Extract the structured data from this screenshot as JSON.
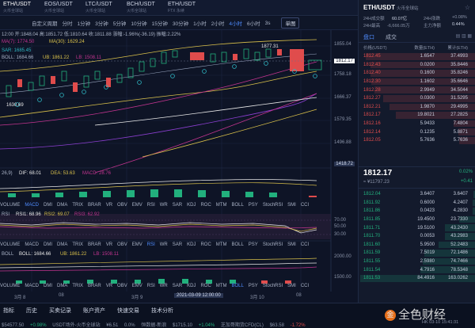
{
  "pair_tabs": [
    {
      "symbol": "ETH/USDT",
      "exchange": "火币全球站"
    },
    {
      "symbol": "EOS/USDT",
      "exchange": "火币全球站"
    },
    {
      "symbol": "LTC/USDT",
      "exchange": "火币全球站"
    },
    {
      "symbol": "BCH/USDT",
      "exchange": "火币全球站"
    },
    {
      "symbol": "ETH/USDT",
      "exchange": "FTX 永续"
    }
  ],
  "toolbar": {
    "items": [
      "自定义周期",
      "分时",
      "1分钟",
      "3分钟",
      "5分钟",
      "10分钟",
      "15分钟",
      "30分钟",
      "1小时",
      "2小时",
      "4小时",
      "6小时",
      "3s"
    ],
    "active": "4小时",
    "chart_select": "单图"
  },
  "legend": {
    "ohlc": "12:00 开:1848.04 高:1851.72 低:1810.64 收:1811.88 涨幅:-1.96%(-36.19) 振幅:2.22%",
    "ma": "MA(7): 1774.50",
    "ma30": "MA(30): 1629.24",
    "sar": "SAR: 1685.45",
    "boll": "BOLL: 1684.66",
    "ub": "UB: 1861.22",
    "lb": "LB: 1508.11",
    "macd_label": "26,9)",
    "dif": "DIF: 68.01",
    "dea": "DEA: 53.63",
    "macd": "MACD: 28.76",
    "rsi_label": "RSI",
    "rsi1": "RSI1: 68.96",
    "rsi2": "RSI2: 69.07",
    "rsi3": "RSI3: 62.92",
    "boll2_label": "BOLL",
    "boll2": "BOLL: 1684.66",
    "ub2": "UB: 1861.22",
    "lb2": "LB: 1508.11"
  },
  "price_axis": [
    "1855.04",
    "1758.18",
    "1666.37",
    "1579.35",
    "1496.88",
    "1418.72"
  ],
  "current_price_tag": "1812.17",
  "high_mark": "1877.31",
  "low_mark": "1630.69",
  "rsi_axis": [
    "70.00",
    "50.00",
    "30.00"
  ],
  "boll_axis": [
    "2000.00",
    "1500.00"
  ],
  "indicators": [
    "VOLUME",
    "MACD",
    "DMI",
    "DMA",
    "TRIX",
    "BRAR",
    "VR",
    "OBV",
    "EMV",
    "RSI",
    "WR",
    "SAR",
    "KDJ",
    "ROC",
    "MTM",
    "BOLL",
    "PSY",
    "StochRSI",
    "SMI",
    "CCI"
  ],
  "indicators_active": [
    "MACD",
    "RSI",
    "BOLL"
  ],
  "date_axis": {
    "left": "3月 8",
    "mid1": "08",
    "mid2": "3月 9",
    "cross": "2021-03-09 12:00:00",
    "mid3": "3月 10",
    "mid4": "08"
  },
  "bottom_tabs": [
    "指标",
    "历史",
    "买卖记录",
    "账户资产",
    "快速交易",
    "技术分析"
  ],
  "ticker": [
    {
      "label": "USDT场外-火币全球站",
      "value": "¥6.51",
      "chg": "0.0%",
      "dir": "flat"
    },
    {
      "label": "恒数据-新浪",
      "value": "$1715.10",
      "chg": "+1.04%",
      "dir": "up"
    },
    {
      "label": "芝加哥期货CFD(CL)",
      "value": "$63.58",
      "chg": "-1.72%",
      "dir": "down"
    }
  ],
  "ticker_left": {
    "value": "$54577.50",
    "chg": "+0.98%"
  },
  "right_panel": {
    "symbol": "ETH/USDT",
    "exchange": "火币全球站",
    "stats": {
      "high_label": "24H成交额",
      "high_val": "60.07亿",
      "low_label": "24H涨跌",
      "low_val": "+0.08%",
      "c_label": "24H最高",
      "c_val": "-6,666.05万",
      "d_label": "主力净额",
      "d_val": "0.44%"
    },
    "tabs": [
      "盘口",
      "成交"
    ],
    "header": [
      "价格(USDT)",
      "数量(ETH)",
      "累计(ETH)"
    ],
    "asks": [
      [
        "1812.45",
        "1.6547",
        "37.4993"
      ],
      [
        "1812.43",
        "0.0200",
        "35.8446"
      ],
      [
        "1812.40",
        "0.1600",
        "35.8246"
      ],
      [
        "1812.30",
        "1.1602",
        "35.6646"
      ],
      [
        "1812.28",
        "2.9949",
        "34.5044"
      ],
      [
        "1812.27",
        "0.0300",
        "31.5295"
      ],
      [
        "1812.21",
        "1.9870",
        "29.4995"
      ],
      [
        "1812.17",
        "19.8021",
        "27.2825"
      ],
      [
        "1812.16",
        "5.9433",
        "7.4804"
      ],
      [
        "1812.14",
        "0.1235",
        "5.8871"
      ],
      [
        "1812.05",
        "5.7636",
        "5.7636"
      ]
    ],
    "mid_price": "1812.17",
    "mid_cny": "≈ ¥11797.23",
    "mid_pct": "0.02%",
    "mid_abs": "+0.41",
    "bids": [
      [
        "1812.04",
        "3.6407",
        "3.6407"
      ],
      [
        "1811.92",
        "0.6000",
        "4.2407"
      ],
      [
        "1811.86",
        "0.0423",
        "4.2830"
      ],
      [
        "1811.85",
        "19.4500",
        "23.7330"
      ],
      [
        "1811.71",
        "19.5100",
        "43.2430"
      ],
      [
        "1811.70",
        "0.0053",
        "43.2983"
      ],
      [
        "1811.60",
        "5.9500",
        "52.2483"
      ],
      [
        "1811.59",
        "7.5019",
        "72.1486"
      ],
      [
        "1811.55",
        "2.5980",
        "74.7466"
      ],
      [
        "1811.54",
        "4.7916",
        "78.5348"
      ],
      [
        "1811.53",
        "84.4916",
        "163.0262"
      ]
    ]
  },
  "watermark": "全色财经",
  "clock": "HK 03-10 15:41:31",
  "colors": {
    "up": "#22b07d",
    "down": "#e04c4c",
    "accent": "#4f8cff",
    "bg": "#0e1426"
  }
}
